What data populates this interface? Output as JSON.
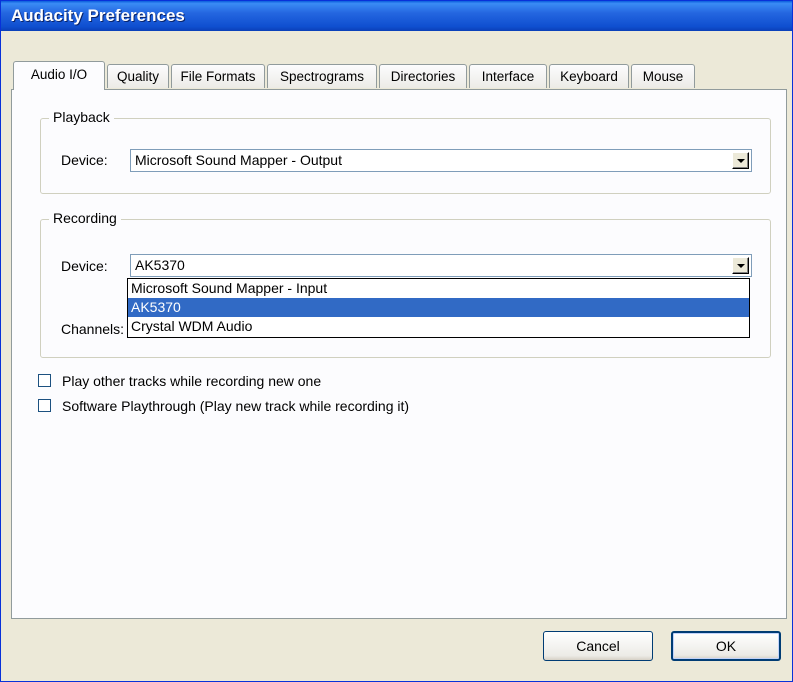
{
  "window": {
    "title": "Audacity Preferences"
  },
  "tabs": [
    {
      "label": "Audio I/O",
      "active": true
    },
    {
      "label": "Quality"
    },
    {
      "label": "File Formats"
    },
    {
      "label": "Spectrograms"
    },
    {
      "label": "Directories"
    },
    {
      "label": "Interface"
    },
    {
      "label": "Keyboard"
    },
    {
      "label": "Mouse"
    }
  ],
  "playback": {
    "legend": "Playback",
    "device_label": "Device:",
    "device_value": "Microsoft Sound Mapper - Output"
  },
  "recording": {
    "legend": "Recording",
    "device_label": "Device:",
    "device_value": "AK5370",
    "channels_label": "Channels:",
    "options": [
      "Microsoft Sound Mapper - Input",
      "AK5370",
      "Crystal WDM Audio"
    ],
    "selected_option": "AK5370"
  },
  "checkboxes": {
    "play_other": {
      "label": "Play other tracks while recording new one",
      "checked": false
    },
    "playthrough": {
      "label": "Software Playthrough (Play new track while recording it)",
      "checked": false
    }
  },
  "buttons": {
    "cancel": "Cancel",
    "ok": "OK"
  },
  "colors": {
    "titlebar": "#0a5ddc",
    "selection": "#316ac5",
    "dialog_bg": "#ece9d8"
  }
}
